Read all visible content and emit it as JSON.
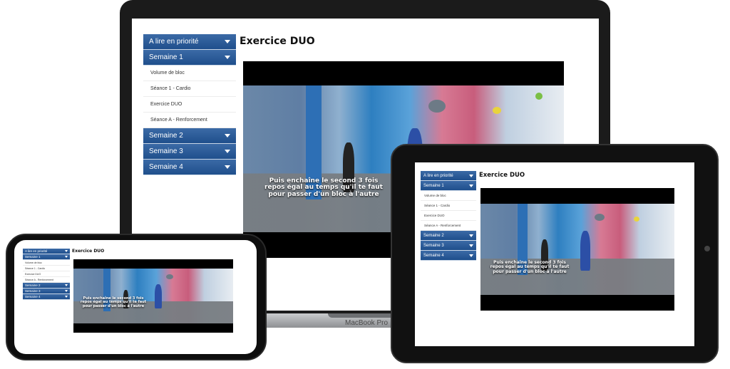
{
  "page": {
    "title": "Exercice DUO",
    "device_label": "MacBook Pro"
  },
  "sidebar": {
    "top": "A lire en priorité",
    "week1": "Semaine 1",
    "week1_items": [
      "Volume de bloc",
      "Séance 1 - Cardio",
      "Exercice DUO",
      "Séance A - Renforcement"
    ],
    "week2": "Semaine 2",
    "week3": "Semaine 3",
    "week4": "Semaine 4"
  },
  "video": {
    "caption_line1": "Puis enchaîne le second 3 fois",
    "caption_line2": "repos égal au temps qu'il te faut",
    "caption_line3": "pour passer d'un bloc à l'autre"
  },
  "colors": {
    "nav_blue": "#2b5c99",
    "video_bg": "#000000"
  }
}
